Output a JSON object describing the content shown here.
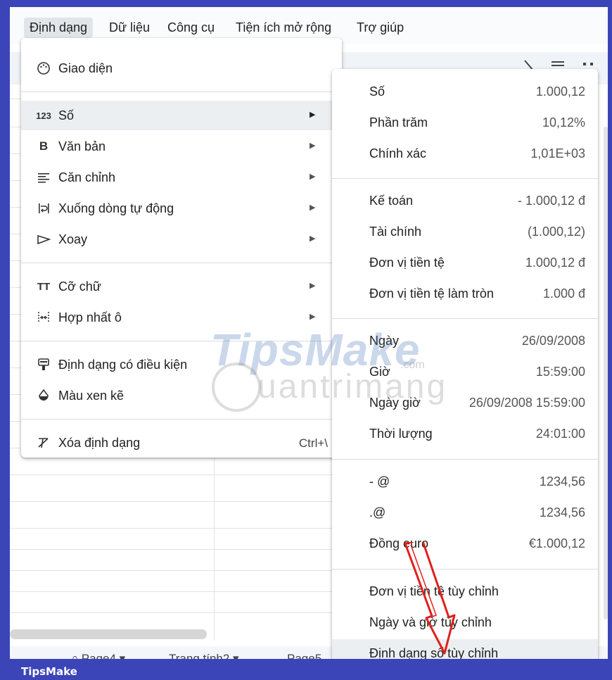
{
  "menubar": {
    "items": [
      "Định dạng",
      "Dữ liệu",
      "Công cụ",
      "Tiện ích mở rộng",
      "Trợ giúp"
    ]
  },
  "format_menu": {
    "items": [
      {
        "label": "Giao diện",
        "icon": "palette-icon"
      },
      {
        "label": "Số",
        "icon": "number-format-icon",
        "icon_text": "123",
        "submenu": true
      },
      {
        "label": "Văn bản",
        "icon": "bold-icon",
        "icon_text": "B",
        "submenu": true
      },
      {
        "label": "Căn chỉnh",
        "icon": "align-icon",
        "submenu": true
      },
      {
        "label": "Xuống dòng tự động",
        "icon": "text-wrap-icon",
        "submenu": true
      },
      {
        "label": "Xoay",
        "icon": "text-rotate-icon",
        "submenu": true
      },
      {
        "label": "Cỡ chữ",
        "icon": "font-size-icon",
        "icon_text": "TT",
        "submenu": true
      },
      {
        "label": "Hợp nhất ô",
        "icon": "merge-cells-icon",
        "submenu": true
      },
      {
        "label": "Định dạng có điều kiện",
        "icon": "conditional-format-icon"
      },
      {
        "label": "Màu xen kẽ",
        "icon": "alternating-colors-icon"
      },
      {
        "label": "Xóa định dạng",
        "icon": "clear-format-icon",
        "shortcut": "Ctrl+\\"
      }
    ]
  },
  "number_submenu": {
    "items": [
      {
        "label": "Số",
        "value": "1.000,12"
      },
      {
        "label": "Phần trăm",
        "value": "10,12%"
      },
      {
        "label": "Chính xác",
        "value": "1,01E+03"
      },
      {
        "label": "Kế toán",
        "value": "- 1.000,12 đ"
      },
      {
        "label": "Tài chính",
        "value": "(1.000,12)"
      },
      {
        "label": "Đơn vị tiền tệ",
        "value": "1.000,12 đ"
      },
      {
        "label": "Đơn vị tiền tệ làm tròn",
        "value": "1.000 đ"
      },
      {
        "label": "Ngày",
        "value": "26/09/2008"
      },
      {
        "label": "Giờ",
        "value": "15:59:00"
      },
      {
        "label": "Ngày giờ",
        "value": "26/09/2008 15:59:00"
      },
      {
        "label": "Thời lượng",
        "value": "24:01:00"
      },
      {
        "label": "- @",
        "value": "1234,56"
      },
      {
        "label": ".@",
        "value": "1234,56"
      },
      {
        "label": "Đồng euro",
        "value": "€1.000,12"
      },
      {
        "label": "Đơn vị tiền tệ tùy chỉnh",
        "value": ""
      },
      {
        "label": "Ngày và giờ tùy chỉnh",
        "value": ""
      },
      {
        "label": "Định dạng số tùy chỉnh",
        "value": ""
      }
    ]
  },
  "sheet_tabs": [
    "Page4",
    "Trang tính2",
    "Page5"
  ],
  "watermark": {
    "brand": "TipsMake",
    "domain": ".com",
    "site": "uantrimang"
  },
  "footer": {
    "brand": "TipsMake"
  },
  "colors": {
    "frame": "#3b45b8",
    "highlight": "#eceff1",
    "arrow": "#e0201c"
  }
}
